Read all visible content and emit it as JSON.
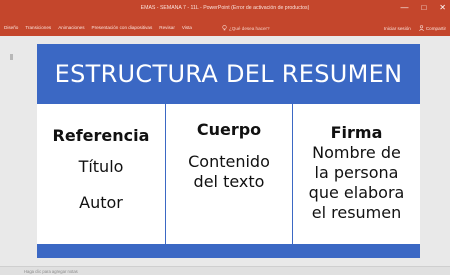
{
  "window": {
    "title": "EMAS - SEMANA 7 - 11L - PowerPoint (Error de activación de productos)",
    "controls": [
      "—",
      "□",
      "✕"
    ]
  },
  "ribbon": {
    "tabs": [
      "Diseño",
      "Transiciones",
      "Animaciones",
      "Presentación con diapositivas",
      "Revisar",
      "Vista"
    ],
    "search_text": "¿Qué desea hacer?",
    "sign_in": "Iniciar sesión",
    "share": "Compartir"
  },
  "slide": {
    "title": "ESTRUCTURA DEL RESUMEN",
    "columns": [
      {
        "header": "Referencia",
        "lines": [
          "Título",
          "Autor"
        ]
      },
      {
        "header": "Cuerpo",
        "lines": [
          "Contenido",
          "del texto"
        ]
      },
      {
        "header": "Firma",
        "lines": [
          "Nombre de",
          "la persona",
          "que elabora",
          "el resumen"
        ]
      }
    ]
  },
  "notes": {
    "placeholder": "Haga clic para agregar notas"
  },
  "colors": {
    "ribbon": "#c4462c",
    "slide_accent": "#3b68c4",
    "workspace": "#e9e9e9"
  }
}
